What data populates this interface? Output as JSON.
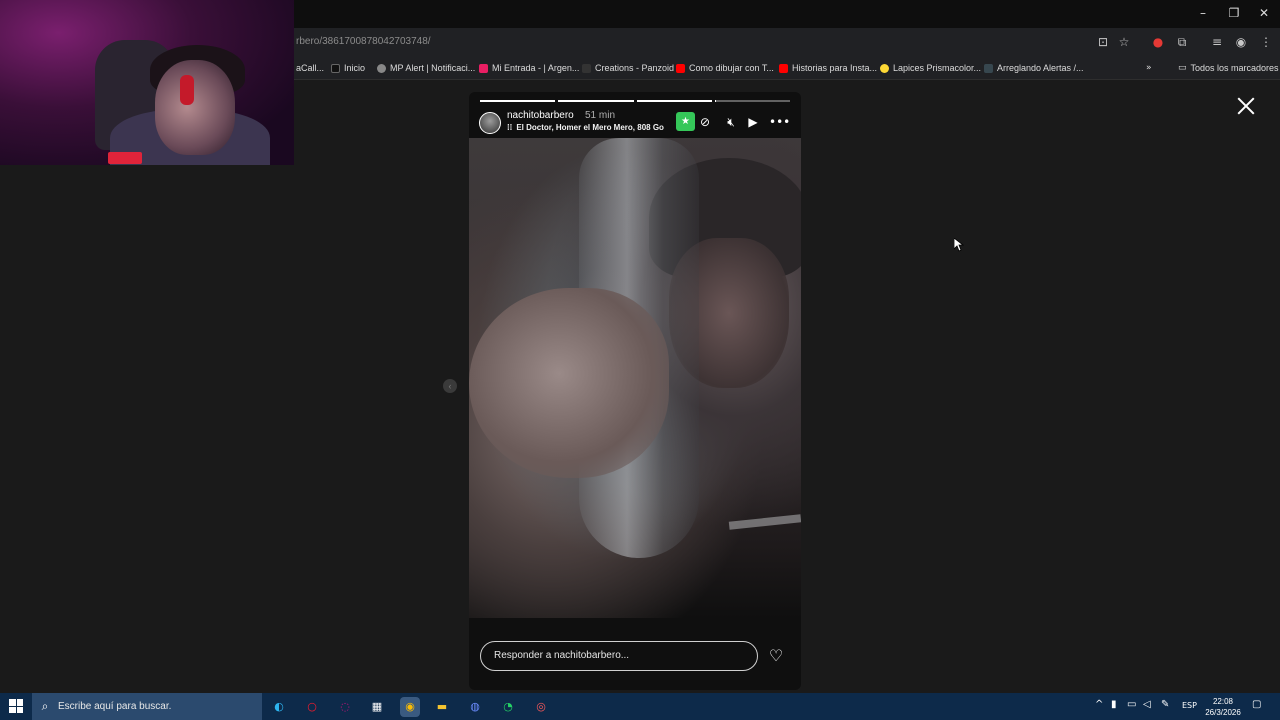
{
  "browser": {
    "url": "rbero/3861700878042703748/",
    "window_controls": [
      "–",
      "❐",
      "✕"
    ],
    "bookmarks": [
      {
        "label": "aCall...",
        "color": "#444"
      },
      {
        "label": "Inicio",
        "color": "#111"
      },
      {
        "label": "MP Alert | Notificaci...",
        "color": "#888"
      },
      {
        "label": "Mi Entrada - | Argen...",
        "color": "#e91e63"
      },
      {
        "label": "Creations - Panzoid",
        "color": "#333"
      },
      {
        "label": "Como dibujar con T...",
        "color": "#ff0000"
      },
      {
        "label": "Historias para Insta...",
        "color": "#ff0000"
      },
      {
        "label": "Lapices Prismacolor...",
        "color": "#fdd835"
      },
      {
        "label": "Arreglando Alertas /...",
        "color": "#37474f"
      }
    ],
    "bookmarks_folder": "Todos los marcadores"
  },
  "story": {
    "username": "nachitobarbero",
    "time": "51 min",
    "music": "El Doctor, Homer el Mero Mero, 808 Go",
    "progress": [
      1,
      1,
      1,
      0.01
    ],
    "reply_placeholder": "Responder a nachitobarbero..."
  },
  "taskbar": {
    "search_placeholder": "Escribe aquí para buscar.",
    "language": "ESP",
    "time": "22:08",
    "date": "26/3/2026"
  }
}
